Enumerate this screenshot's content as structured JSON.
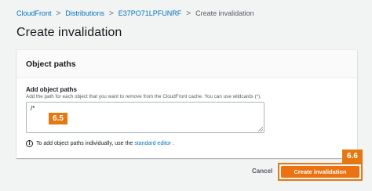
{
  "breadcrumb": {
    "items": [
      "CloudFront",
      "Distributions",
      "E37PO71LPFUNRF"
    ],
    "current": "Create invalidation",
    "separator": ">"
  },
  "page": {
    "title": "Create invalidation"
  },
  "panel": {
    "title": "Object paths",
    "field_label": "Add object paths",
    "field_description": "Add the path for each object that you want to remove from the CloudFront cache. You can use wildcards (*).",
    "field_value": "/*",
    "info_icon": "i",
    "info_prefix": "To add object paths individually, use the",
    "info_link": "standard editor",
    "info_suffix": "."
  },
  "footer": {
    "cancel_label": "Cancel",
    "create_label": "Create invalidation"
  },
  "annotations": {
    "step_textarea": "6.5",
    "step_create": "6.6"
  },
  "colors": {
    "accent": "#ec7211",
    "callout": "#e47911",
    "link": "#0073bb",
    "background": "#f2f3f3"
  },
  "icons": {
    "separator": "chevron-right-icon",
    "info": "info-icon",
    "resize": "resize-grip-icon"
  }
}
